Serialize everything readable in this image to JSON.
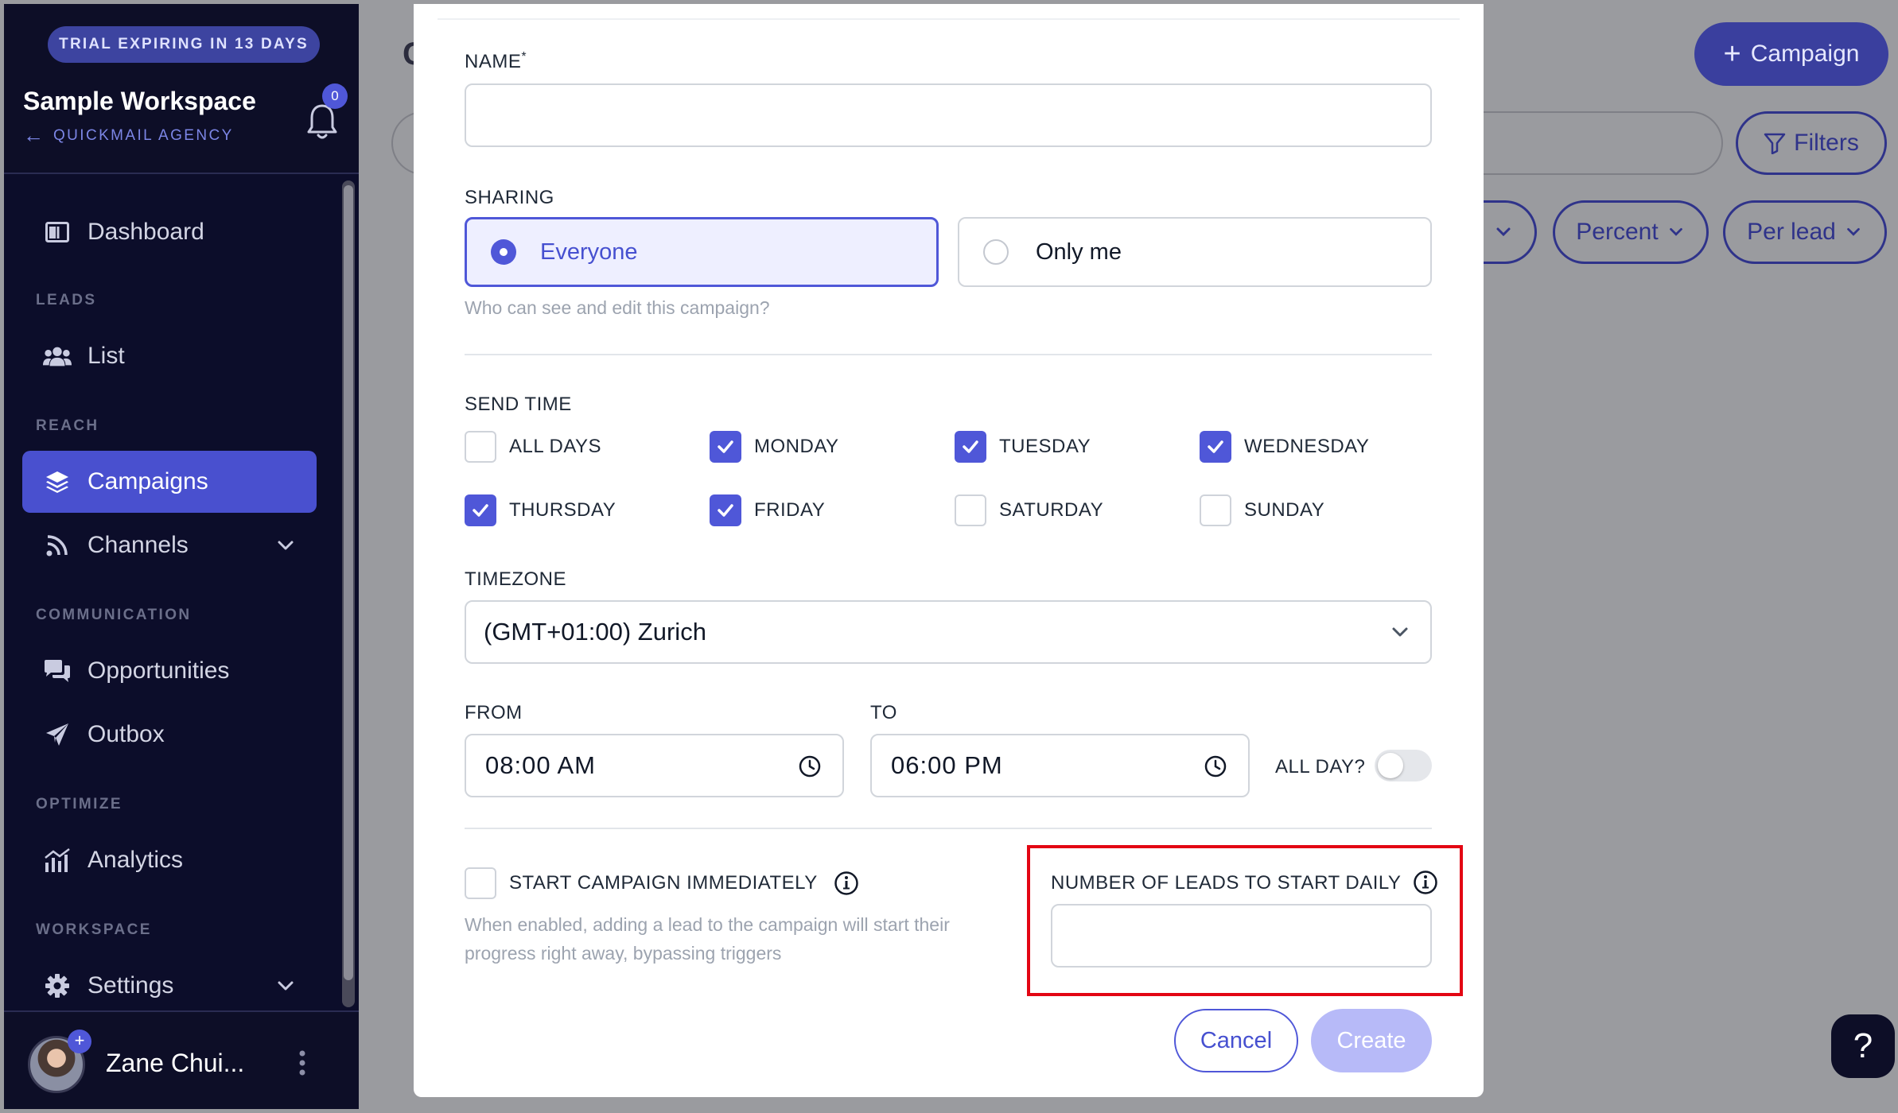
{
  "sidebar": {
    "trial_badge": "TRIAL EXPIRING IN 13 DAYS",
    "workspace_name": "Sample Workspace",
    "agency_link": "QUICKMAIL AGENCY",
    "notification_count": "0",
    "sections": {
      "leads": "LEADS",
      "reach": "REACH",
      "communication": "COMMUNICATION",
      "optimize": "OPTIMIZE",
      "workspace": "WORKSPACE"
    },
    "items": {
      "dashboard": "Dashboard",
      "list": "List",
      "campaigns": "Campaigns",
      "channels": "Channels",
      "opportunities": "Opportunities",
      "outbox": "Outbox",
      "analytics": "Analytics",
      "settings": "Settings"
    },
    "active_item": "campaigns",
    "user_name": "Zane Chui...",
    "avatar_plus": "+"
  },
  "background": {
    "title_letter": "C",
    "campaign_button": "Campaign",
    "filters_button": "Filters",
    "percent_button": "Percent",
    "per_lead_button": "Per lead",
    "help_button": "?"
  },
  "modal": {
    "name_label": "NAME",
    "name_required_mark": "*",
    "name_value": "",
    "sharing_label": "SHARING",
    "sharing_options": [
      "Everyone",
      "Only me"
    ],
    "sharing_selected": "Everyone",
    "sharing_hint": "Who can see and edit this campaign?",
    "send_time_label": "SEND TIME",
    "days": [
      {
        "label": "ALL DAYS",
        "checked": false
      },
      {
        "label": "MONDAY",
        "checked": true
      },
      {
        "label": "TUESDAY",
        "checked": true
      },
      {
        "label": "WEDNESDAY",
        "checked": true
      },
      {
        "label": "THURSDAY",
        "checked": true
      },
      {
        "label": "FRIDAY",
        "checked": true
      },
      {
        "label": "SATURDAY",
        "checked": false
      },
      {
        "label": "SUNDAY",
        "checked": false
      }
    ],
    "timezone_label": "TIMEZONE",
    "timezone_value": "(GMT+01:00) Zurich",
    "from_label": "FROM",
    "from_value": "08:00 AM",
    "to_label": "TO",
    "to_value": "06:00 PM",
    "all_day_label": "ALL DAY?",
    "all_day_on": false,
    "start_immediately_label": "START CAMPAIGN IMMEDIATELY",
    "start_immediately_checked": false,
    "start_immediately_hint_line1": "When enabled, adding a lead to the campaign will start their",
    "start_immediately_hint_line2": "progress right away, bypassing triggers",
    "leads_daily_label": "NUMBER OF LEADS TO START DAILY",
    "leads_daily_value": "",
    "cancel_button": "Cancel",
    "create_button": "Create"
  },
  "colors": {
    "accent": "#4f57d8",
    "sidebar_bg": "#0d0e27",
    "highlight_frame": "#e30613",
    "create_disabled": "#b7baf8"
  }
}
